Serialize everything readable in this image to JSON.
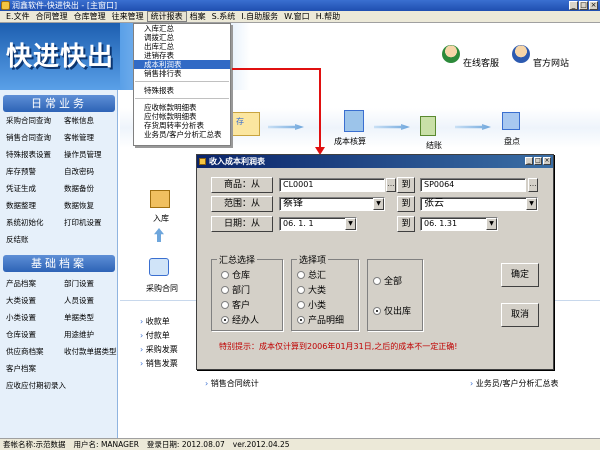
{
  "window": {
    "title": "润鑫软件-快进快出 - [主窗口]"
  },
  "menubar": {
    "items": [
      "E.文件",
      "合同管理",
      "仓库管理",
      "往来管理",
      "统计报表",
      "档案",
      "S.系统",
      "I.自助服务",
      "W.窗口",
      "H.帮助"
    ],
    "active_index": 4
  },
  "banner": {
    "logo": "快进快出",
    "online_service": "在线客服",
    "official_site": "官方网站"
  },
  "dropdown": {
    "items": [
      "入库汇总",
      "调拨汇总",
      "出库汇总",
      "进销存表",
      "成本利润表",
      "销售排行表",
      "特殊报表",
      "应收帐款明细表",
      "应付帐款明细表",
      "存货周转率分析表",
      "业务员/客户分析汇总表"
    ],
    "highlight_index": 4
  },
  "sidebar": {
    "daily_header": "日常业务",
    "daily_items": [
      "采购合同查询",
      "客帐信息",
      "销售合同查询",
      "客帐管理",
      "特殊报表设置",
      "操作员管理",
      "库存预警",
      "自改密码",
      "凭证生成",
      "数据备份",
      "数据整理",
      "数据恢复",
      "系统初始化",
      "打印机设置",
      "反结账"
    ],
    "archive_header": "基础档案",
    "archive_items": [
      "产品档案",
      "部门设置",
      "大类设置",
      "人员设置",
      "小类设置",
      "单据类型",
      "仓库设置",
      "用途维护",
      "供应商档案",
      "收付款单据类型",
      "客户档案",
      "应收应付期初录入"
    ]
  },
  "flow": {
    "inbound": "入库",
    "purchase_contract": "采购合同",
    "cost_accounting": "成本核算",
    "settlement": "结账",
    "inventory": "盘点",
    "store_partial": "存"
  },
  "links": {
    "left": [
      "收款单",
      "付款单",
      "采购发票",
      "销售发票"
    ],
    "sales_stats": "销售合同统计",
    "salesman_report": "业务员/客户分析汇总表"
  },
  "dialog": {
    "title": "收入成本利润表",
    "product_label": "商品：从",
    "product_from": "CL0001",
    "to_label": "到",
    "product_to": "SP0064",
    "range_label": "范围：从",
    "range_from": "蔡锋",
    "range_to": "张云",
    "date_label": "日期：从",
    "date_from": "06. 1. 1",
    "date_to": "06. 1.31",
    "summary_group": "汇总选择",
    "summary_options": [
      "仓库",
      "部门",
      "客户",
      "经办人"
    ],
    "summary_selected": 3,
    "select_group": "选择项",
    "select_options": [
      "总汇",
      "大类",
      "小类",
      "产品明细"
    ],
    "select_selected": 3,
    "scope_options": [
      "全部",
      "仅出库"
    ],
    "scope_selected": 1,
    "ok_label": "确定",
    "cancel_label": "取消",
    "hint": "特别提示：成本仅计算到2006年01月31日,之后的成本不一定正确!"
  },
  "statusbar": {
    "account": "套帐名称:示范数据",
    "user": "用户名: MANAGER",
    "login_date": "登录日期: 2012.08.07",
    "version": "ver.2012.04.25"
  },
  "colors": {
    "accent": "#316ac5",
    "title_bar": "#0a246a",
    "hint": "#c00000",
    "arrow": "#e01010"
  }
}
